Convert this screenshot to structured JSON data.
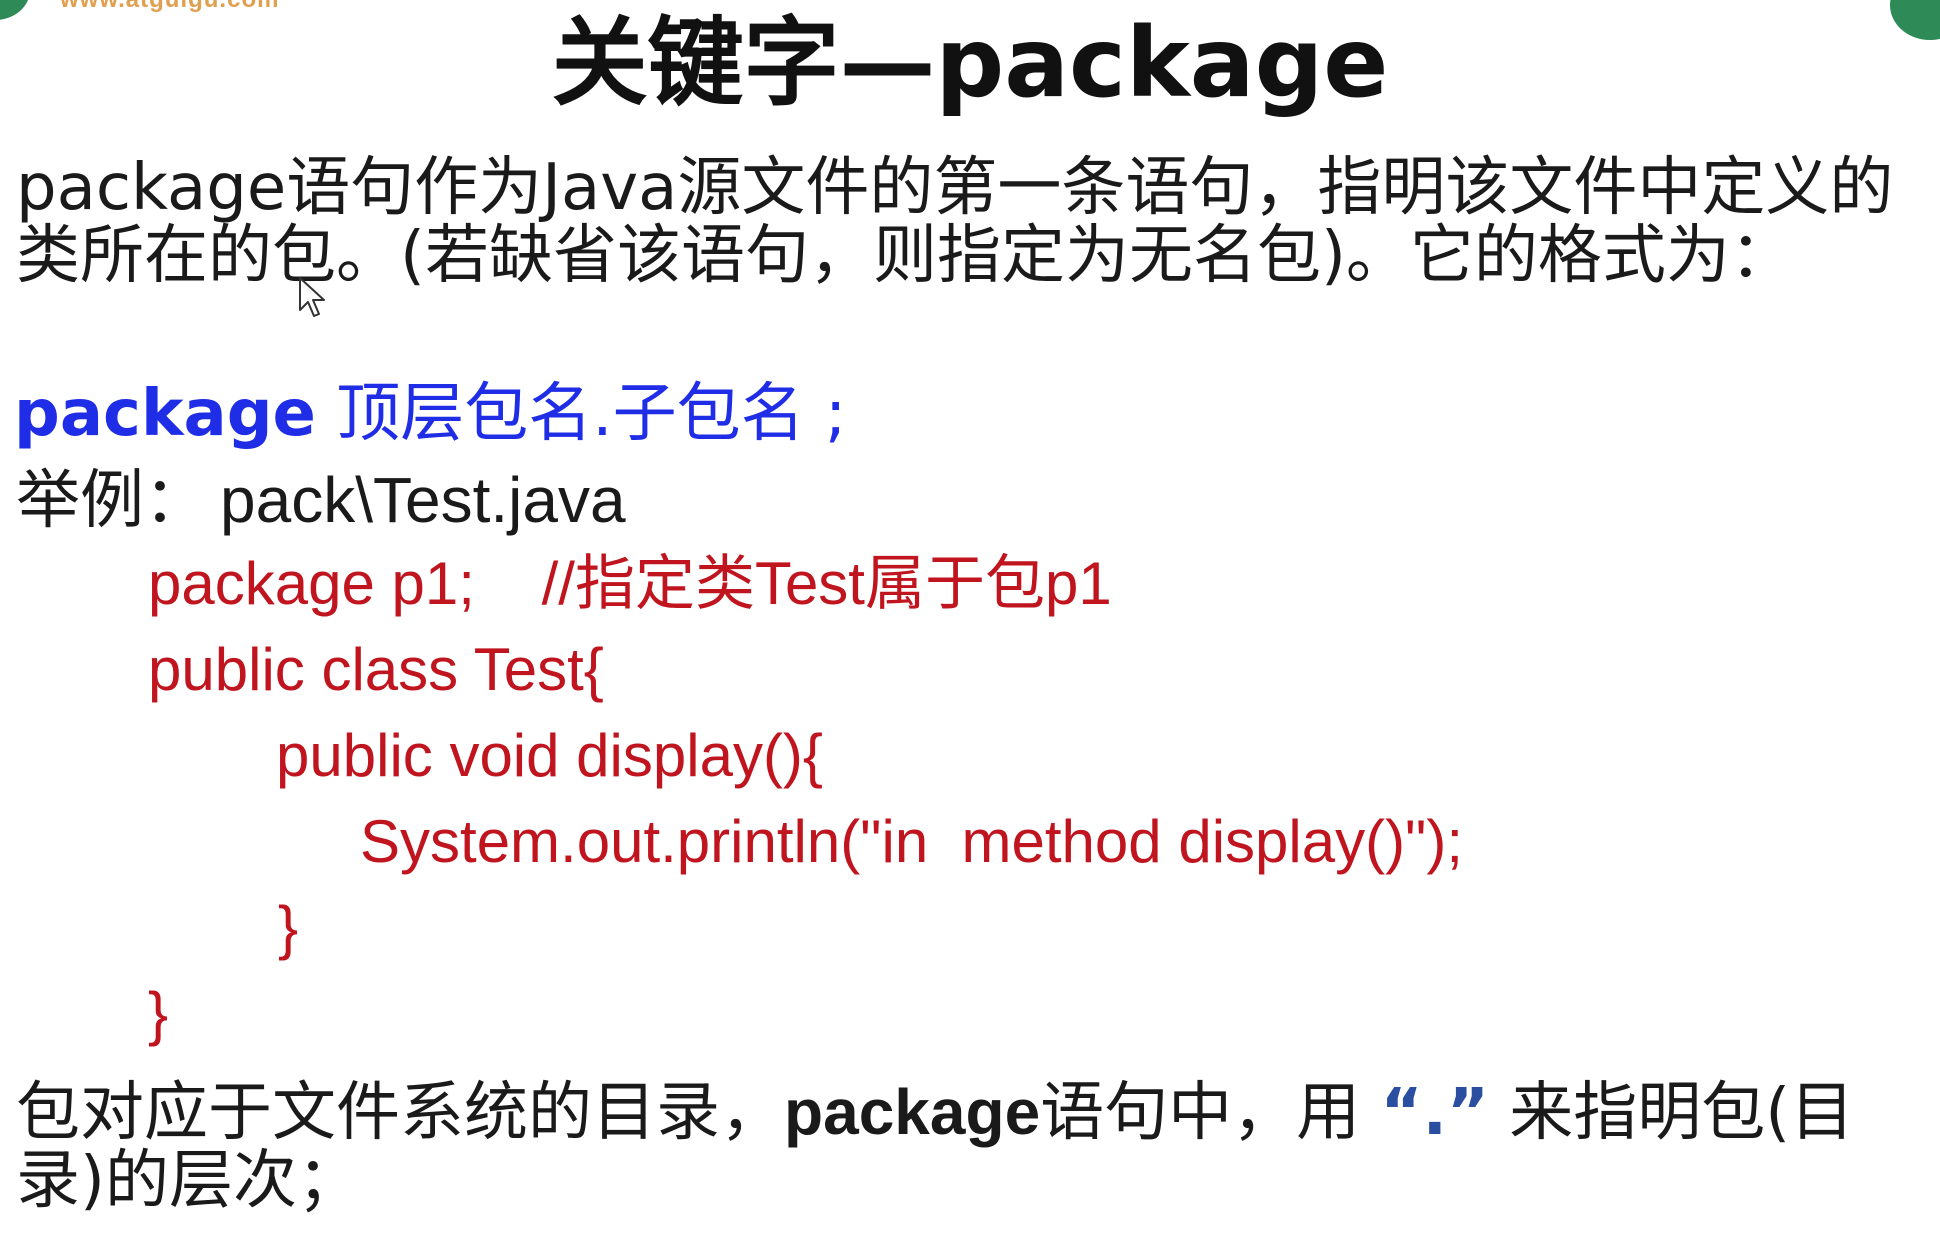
{
  "watermark": "www.atguigu.com",
  "title": "关键字—package",
  "intro": "package语句作为Java源文件的第一条语句，指明该文件中定义的类所在的包。(若缺省该语句，则指定为无名包)。它的格式为：",
  "syntax": {
    "keyword": "package",
    "rest": "顶层包名.子包名 ;"
  },
  "example": {
    "label": "举例：",
    "file": "pack\\Test.java"
  },
  "code": [
    "package p1;    //指定类Test属于包p1",
    "public class Test{",
    "public void display(){",
    "System.out.println(\"in  method display()\");",
    "}",
    "}"
  ],
  "outro": {
    "part1": "包对应于文件系统的目录，",
    "keyword": "package",
    "part2": "语句中，用 ",
    "dot": "“.”",
    "part3": " 来指明包(目录)的层次；"
  },
  "colors": {
    "syntax": "#1f2de6",
    "code": "#c0141e",
    "corner": "#2e8b57"
  },
  "icons": [
    "mouse-pointer-icon"
  ]
}
